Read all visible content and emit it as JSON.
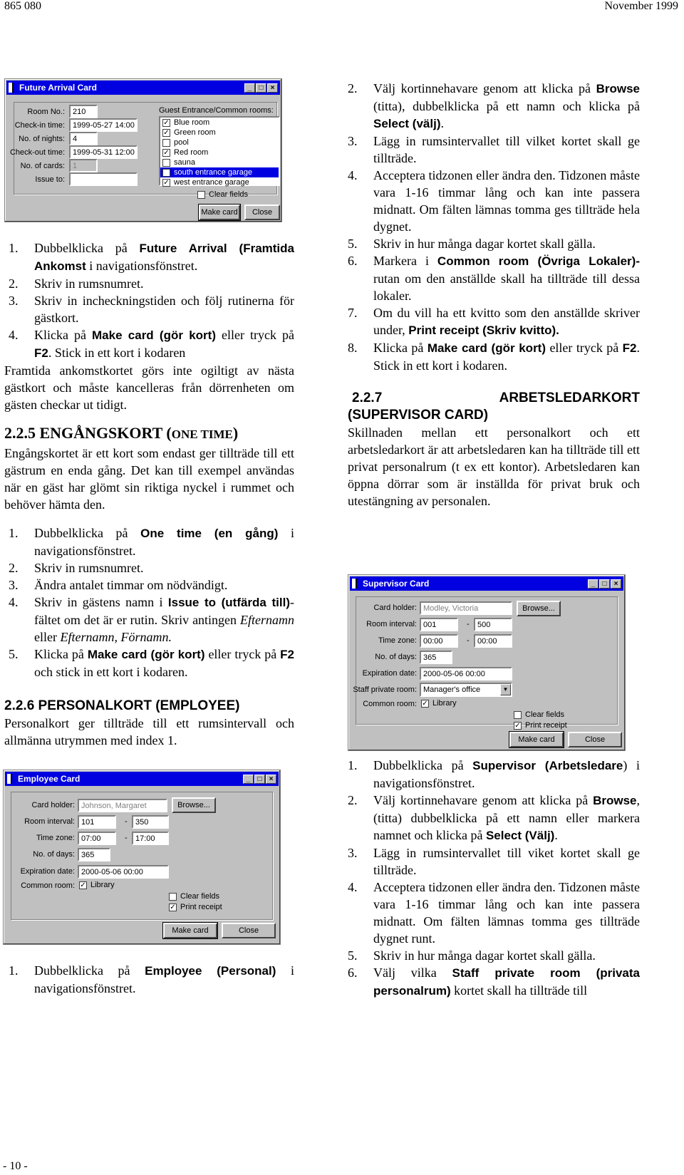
{
  "header": {
    "doc_number": "865 080",
    "date": "November 1999"
  },
  "footer": {
    "page_number": "- 10 -"
  },
  "future_arrival_card": {
    "title": "Future Arrival Card",
    "fields": {
      "room_no_label": "Room No.:",
      "room_no": "210",
      "checkin_label": "Check-in time:",
      "checkin": "1999-05-27 14:00",
      "nights_label": "No. of nights:",
      "nights": "4",
      "checkout_label": "Check-out time:",
      "checkout": "1999-05-31 12:00",
      "cards_label": "No. of cards:",
      "cards": "1",
      "issue_label": "Issue to:",
      "issue": ""
    },
    "rooms_label": "Guest Entrance/Common rooms:",
    "rooms": [
      {
        "name": "Blue room",
        "checked": true,
        "selected": false
      },
      {
        "name": "Green room",
        "checked": true,
        "selected": false
      },
      {
        "name": "pool",
        "checked": false,
        "selected": false
      },
      {
        "name": "Red room",
        "checked": true,
        "selected": false
      },
      {
        "name": "sauna",
        "checked": false,
        "selected": false
      },
      {
        "name": "south entrance garage",
        "checked": true,
        "selected": true
      },
      {
        "name": "west entrance garage",
        "checked": true,
        "selected": false
      }
    ],
    "clear_fields": {
      "label": "Clear fields",
      "checked": false
    },
    "make_card": "Make card",
    "close": "Close"
  },
  "left": {
    "fa_steps": [
      {
        "n": "1.",
        "pre": "Dubbelklicka på ",
        "bold": "Future Arrival (Framtida Ankomst",
        "post": " i navigationsfönstret."
      },
      {
        "n": "2.",
        "text": "Skriv in rumsnumret."
      },
      {
        "n": "3.",
        "text": "Skriv in incheckningstiden och följ rutinerna för gästkort."
      },
      {
        "n": "4.",
        "pre": "Klicka på ",
        "bold": "Make card (gör kort)",
        "mid": " eller tryck på ",
        "bold2": "F2",
        "post": ". Stick in ett kort i kodaren"
      }
    ],
    "fa_note": "Framtida ankomstkortet görs inte ogiltigt av nästa gästkort och måste kancelleras från dörrenheten om gästen checkar ut tidigt.",
    "onetime_heading_main": "2.2.5 ENGÅNGSKORT (",
    "onetime_heading_sc": "ONE TIME",
    "onetime_heading_end": ")",
    "onetime_intro": "Engångskortet är ett kort som endast ger tillträde till ett gästrum en enda gång. Det kan till exempel användas när en gäst har glömt sin riktiga nyckel i rummet och behöver hämta den.",
    "ot_steps": {
      "s1_n": "1.",
      "s1_pre": "Dubbelklicka på ",
      "s1_bold": "One time (en gång)",
      "s1_post": " i navigationsfönstret.",
      "s2_n": "2.",
      "s2": "Skriv in rumsnumret.",
      "s3_n": "3.",
      "s3": "Ändra antalet timmar om nödvändigt.",
      "s4_n": "4.",
      "s4_pre": "Skriv in gästens namn i ",
      "s4_bold": "Issue to (utfärda till)",
      "s4_mid": "-fältet om det är er rutin. Skriv antingen ",
      "s4_it1": "Efternamn",
      "s4_mid2": " eller ",
      "s4_it2": "Efternamn, Förnamn.",
      "s5_n": "5.",
      "s5_pre": "Klicka på ",
      "s5_bold": "Make card (gör kort)",
      "s5_mid": " eller tryck på ",
      "s5_bold2": "F2",
      "s5_post": " och stick in ett kort i kodaren."
    },
    "employee_heading": "2.2.6 PERSONALKORT (EMPLOYEE)",
    "employee_intro": "Personalkort ger tillträde till ett rumsintervall och allmänna utrymmen med index 1.",
    "emp_step1_n": "1.",
    "emp_step1_pre": "Dubbelklicka på ",
    "emp_step1_bold": "Employee (Personal)",
    "emp_step1_post": " i navigationsfönstret."
  },
  "employee_card": {
    "title": "Employee Card",
    "card_holder_label": "Card holder:",
    "card_holder": "Johnson, Margaret",
    "browse": "Browse...",
    "room_interval_label": "Room interval:",
    "room_from": "101",
    "room_to": "350",
    "time_zone_label": "Time zone:",
    "time_from": "07:00",
    "time_to": "17:00",
    "days_label": "No. of days:",
    "days": "365",
    "expiration_label": "Expiration date:",
    "expiration": "2000-05-06 00:00",
    "common_room_label": "Common room:",
    "common_room": "Library",
    "common_room_checked": true,
    "clear_fields": "Clear fields",
    "clear_fields_checked": false,
    "print_receipt": "Print receipt",
    "print_receipt_checked": true,
    "make_card": "Make card",
    "close": "Close",
    "separator": "-"
  },
  "right": {
    "s2_n": "2.",
    "s2_pre": "Välj kortinnehavare genom att klicka på ",
    "s2_bold": "Browse",
    "s2_mid": " (titta), dubbelklicka på ett namn och klicka på ",
    "s2_bold2": "Select (välj)",
    "s2_post": ".",
    "s3_n": "3.",
    "s3": "Lägg in rumsintervallet till vilket kortet skall ge tillträde.",
    "s4_n": "4.",
    "s4": "Acceptera tidzonen eller ändra den. Tidzonen måste vara 1-16 timmar lång och kan inte passera midnatt. Om fälten lämnas tomma ges tillträde hela dygnet.",
    "s5_n": "5.",
    "s5": "Skriv in hur många dagar kortet skall gälla.",
    "s6_n": "6.",
    "s6_pre": "Markera i ",
    "s6_bold": "Common room (Övriga Lokaler)-",
    "s6_post": " rutan om den anställde skall ha tillträde till dessa lokaler.",
    "s7_n": "7.",
    "s7_pre": "Om du vill ha ett kvitto som den anställde skriver under, ",
    "s7_bold": "Print receipt (Skriv kvitto).",
    "s8_n": "8.",
    "s8_pre": "Klicka på ",
    "s8_bold": "Make card (gör kort)",
    "s8_mid": " eller tryck på ",
    "s8_bold2": "F2",
    "s8_post": ". Stick in ett kort i kodaren.",
    "supervisor_heading_num": "2.2.7",
    "supervisor_heading_word": "ARBETSLEDARKORT",
    "supervisor_heading_line2": "(SUPERVISOR CARD)",
    "supervisor_intro": "Skillnaden mellan ett personalkort och ett arbetsledarkort är att arbetsledaren kan ha tillträde till ett privat personalrum (t ex ett kontor). Arbetsledaren kan öppna dörrar som är inställda för privat bruk och utestängning av personalen.",
    "sv_steps": {
      "s1_n": "1.",
      "s1_pre": "Dubbelklicka på ",
      "s1_bold": "Supervisor (Arbetsledare",
      "s1_post": ") i navigationsfönstret.",
      "s2_n": "2.",
      "s2_pre": "Välj kortinnehavare genom att klicka på ",
      "s2_bold": "Browse",
      "s2_mid": ", (titta) dubbelklicka på ett namn eller markera namnet och klicka på ",
      "s2_bold2": "Select (Välj)",
      "s2_post": ".",
      "s3_n": "3.",
      "s3": "Lägg in rumsintervallet till viket kortet skall ge tillträde.",
      "s4_n": "4.",
      "s4": "Acceptera tidzonen eller ändra den. Tidzonen måste vara 1-16 timmar lång och kan inte passera midnatt. Om fälten lämnas tomma ges tillträde dygnet runt.",
      "s5_n": "5.",
      "s5": "Skriv in hur många dagar kortet skall gälla.",
      "s6_n": "6.",
      "s6_pre": "Välj vilka ",
      "s6_bold": "Staff private room (privata personalrum)",
      "s6_post": " kortet skall ha tillträde till"
    }
  },
  "supervisor_card": {
    "title": "Supervisor Card",
    "card_holder_label": "Card holder:",
    "card_holder": "Modley, Victoria",
    "browse": "Browse...",
    "room_interval_label": "Room interval:",
    "room_from": "001",
    "room_to": "500",
    "time_zone_label": "Time zone:",
    "time_from": "00:00",
    "time_to": "00:00",
    "days_label": "No. of days:",
    "days": "365",
    "expiration_label": "Expiration date:",
    "expiration": "2000-05-06 00:00",
    "staff_room_label": "Staff private room:",
    "staff_room": "Manager's office",
    "common_room_label": "Common room:",
    "common_room": "Library",
    "common_room_checked": true,
    "clear_fields": "Clear fields",
    "clear_fields_checked": false,
    "print_receipt": "Print receipt",
    "print_receipt_checked": true,
    "make_card": "Make card",
    "close": "Close",
    "separator": "-"
  },
  "icons": {
    "minimize": "_",
    "maximize": "□",
    "close": "×",
    "check": "✓",
    "dropdown": "▼"
  }
}
